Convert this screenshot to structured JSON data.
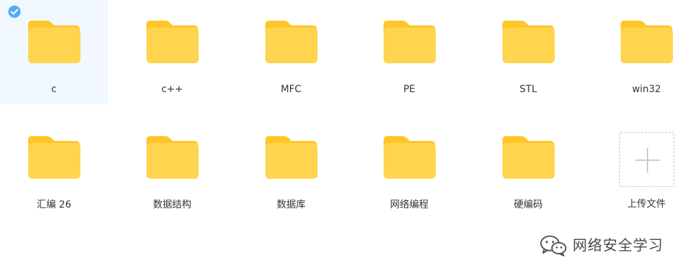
{
  "folders": [
    {
      "name": "c",
      "selected": true
    },
    {
      "name": "c++",
      "selected": false
    },
    {
      "name": "MFC",
      "selected": false
    },
    {
      "name": "PE",
      "selected": false
    },
    {
      "name": "STL",
      "selected": false
    },
    {
      "name": "win32",
      "selected": false
    },
    {
      "name": "汇编 26",
      "selected": false
    },
    {
      "name": "数据结构",
      "selected": false
    },
    {
      "name": "数据库",
      "selected": false
    },
    {
      "name": "网络编程",
      "selected": false
    },
    {
      "name": "硬编码",
      "selected": false
    }
  ],
  "upload": {
    "label": "上传文件",
    "icon": "plus-icon"
  },
  "watermark": {
    "text": "网络安全学习",
    "icon": "wechat-icon"
  },
  "colors": {
    "folder": "#ffd54f",
    "folder_tab": "#ffc629",
    "selected_bg": "#f1f8ff",
    "check": "#5aa9f7"
  }
}
